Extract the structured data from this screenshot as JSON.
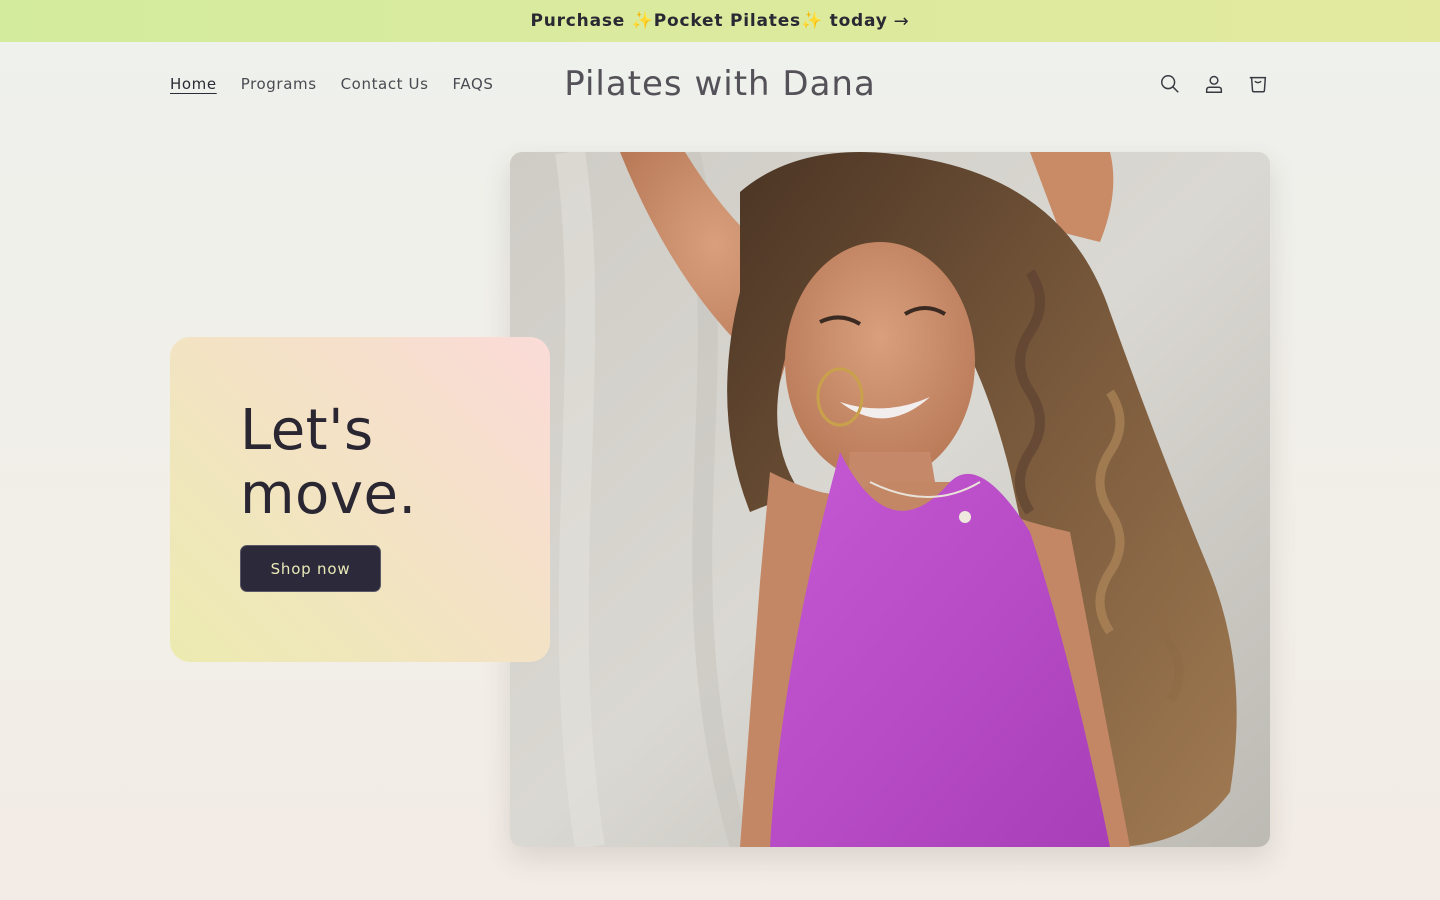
{
  "announcement": {
    "text": "Purchase ✨Pocket Pilates✨ today",
    "arrow": "→"
  },
  "nav": {
    "items": [
      {
        "label": "Home",
        "active": true
      },
      {
        "label": "Programs",
        "active": false
      },
      {
        "label": "Contact Us",
        "active": false
      },
      {
        "label": "FAQS",
        "active": false
      }
    ]
  },
  "brand": {
    "name": "Pilates with Dana"
  },
  "header_icons": [
    "search-icon",
    "account-icon",
    "cart-icon"
  ],
  "hero": {
    "title_line1": "Let's",
    "title_line2": "move.",
    "button_label": "Shop now",
    "image_subject": "smiling woman with curly hair in magenta tank top"
  },
  "colors": {
    "announcement_bg": "#d3eb9d",
    "button_bg": "#2c2a3a",
    "button_text": "#eaeab8",
    "top_color": "#b84bc8"
  }
}
